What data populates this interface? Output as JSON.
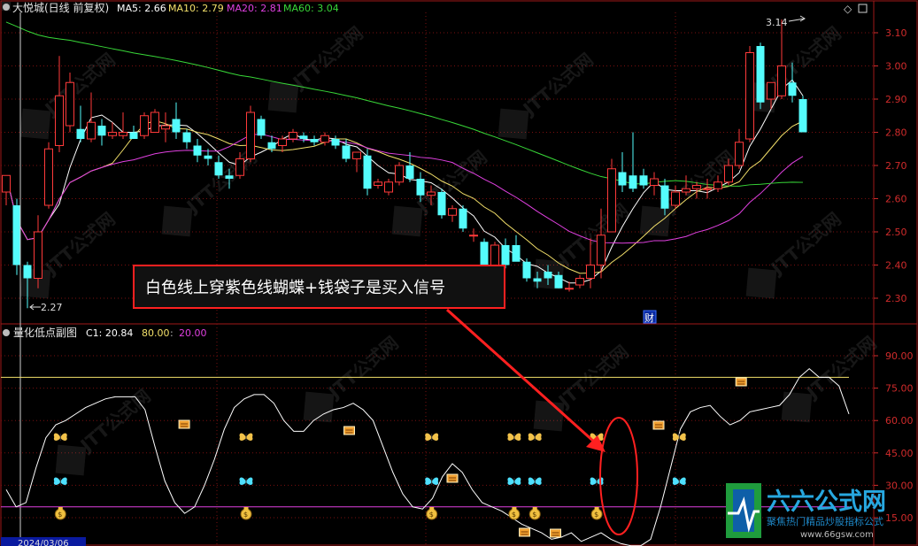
{
  "chart_data": [
    {
      "type": "candlestick",
      "title": "大悦城(日线 前复权)",
      "ma": [
        {
          "name": "MA5",
          "label": "MA5: 2.66",
          "color": "#ffffff"
        },
        {
          "name": "MA10",
          "label": "MA10: 2.79",
          "color": "#f3e06a"
        },
        {
          "name": "MA20",
          "label": "MA20: 2.81",
          "color": "#e040e0"
        },
        {
          "name": "MA60",
          "label": "MA60: 3.04",
          "color": "#38d838"
        }
      ],
      "ylim": [
        2.23,
        3.2
      ],
      "y_ticks": [
        "3.10",
        "3.00",
        "2.90",
        "2.80",
        "2.70",
        "2.60",
        "2.50",
        "2.40",
        "2.30"
      ],
      "high_label": "3.14",
      "low_label": "2.27",
      "event_label": "财",
      "annotation": "白色线上穿紫色线蝴蝶+钱袋子是买入信号",
      "candles": [
        {
          "o": 2.62,
          "h": 2.67,
          "l": 2.58,
          "c": 2.67
        },
        {
          "o": 2.58,
          "h": 2.6,
          "l": 2.37,
          "c": 2.4
        },
        {
          "o": 2.4,
          "h": 2.41,
          "l": 2.27,
          "c": 2.36
        },
        {
          "o": 2.36,
          "h": 2.55,
          "l": 2.33,
          "c": 2.5
        },
        {
          "o": 2.58,
          "h": 2.77,
          "l": 2.57,
          "c": 2.75
        },
        {
          "o": 2.76,
          "h": 3.03,
          "l": 2.74,
          "c": 2.91
        },
        {
          "o": 2.82,
          "h": 2.98,
          "l": 2.8,
          "c": 2.95
        },
        {
          "o": 2.81,
          "h": 2.88,
          "l": 2.77,
          "c": 2.78
        },
        {
          "o": 2.78,
          "h": 2.92,
          "l": 2.77,
          "c": 2.83
        },
        {
          "o": 2.82,
          "h": 2.84,
          "l": 2.76,
          "c": 2.79
        },
        {
          "o": 2.79,
          "h": 2.83,
          "l": 2.78,
          "c": 2.8
        },
        {
          "o": 2.79,
          "h": 2.86,
          "l": 2.78,
          "c": 2.8
        },
        {
          "o": 2.8,
          "h": 2.82,
          "l": 2.78,
          "c": 2.78
        },
        {
          "o": 2.79,
          "h": 2.86,
          "l": 2.78,
          "c": 2.85
        },
        {
          "o": 2.8,
          "h": 2.87,
          "l": 2.8,
          "c": 2.86
        },
        {
          "o": 2.81,
          "h": 2.86,
          "l": 2.77,
          "c": 2.82
        },
        {
          "o": 2.84,
          "h": 2.89,
          "l": 2.78,
          "c": 2.8
        },
        {
          "o": 2.8,
          "h": 2.81,
          "l": 2.75,
          "c": 2.77
        },
        {
          "o": 2.76,
          "h": 2.78,
          "l": 2.71,
          "c": 2.73
        },
        {
          "o": 2.73,
          "h": 2.75,
          "l": 2.7,
          "c": 2.72
        },
        {
          "o": 2.71,
          "h": 2.73,
          "l": 2.66,
          "c": 2.67
        },
        {
          "o": 2.67,
          "h": 2.69,
          "l": 2.63,
          "c": 2.66
        },
        {
          "o": 2.67,
          "h": 2.74,
          "l": 2.66,
          "c": 2.72
        },
        {
          "o": 2.72,
          "h": 2.88,
          "l": 2.71,
          "c": 2.86
        },
        {
          "o": 2.84,
          "h": 2.85,
          "l": 2.78,
          "c": 2.79
        },
        {
          "o": 2.77,
          "h": 2.79,
          "l": 2.74,
          "c": 2.75
        },
        {
          "o": 2.76,
          "h": 2.79,
          "l": 2.74,
          "c": 2.78
        },
        {
          "o": 2.78,
          "h": 2.81,
          "l": 2.77,
          "c": 2.8
        },
        {
          "o": 2.79,
          "h": 2.8,
          "l": 2.77,
          "c": 2.78
        },
        {
          "o": 2.78,
          "h": 2.79,
          "l": 2.76,
          "c": 2.77
        },
        {
          "o": 2.77,
          "h": 2.8,
          "l": 2.76,
          "c": 2.79
        },
        {
          "o": 2.78,
          "h": 2.79,
          "l": 2.75,
          "c": 2.76
        },
        {
          "o": 2.76,
          "h": 2.78,
          "l": 2.71,
          "c": 2.72
        },
        {
          "o": 2.72,
          "h": 2.74,
          "l": 2.68,
          "c": 2.74
        },
        {
          "o": 2.73,
          "h": 2.75,
          "l": 2.61,
          "c": 2.63
        },
        {
          "o": 2.64,
          "h": 2.66,
          "l": 2.63,
          "c": 2.65
        },
        {
          "o": 2.62,
          "h": 2.66,
          "l": 2.61,
          "c": 2.65
        },
        {
          "o": 2.65,
          "h": 2.71,
          "l": 2.64,
          "c": 2.7
        },
        {
          "o": 2.7,
          "h": 2.74,
          "l": 2.65,
          "c": 2.66
        },
        {
          "o": 2.66,
          "h": 2.68,
          "l": 2.59,
          "c": 2.61
        },
        {
          "o": 2.61,
          "h": 2.64,
          "l": 2.58,
          "c": 2.62
        },
        {
          "o": 2.62,
          "h": 2.63,
          "l": 2.54,
          "c": 2.55
        },
        {
          "o": 2.55,
          "h": 2.58,
          "l": 2.53,
          "c": 2.57
        },
        {
          "o": 2.57,
          "h": 2.58,
          "l": 2.5,
          "c": 2.51
        },
        {
          "o": 2.49,
          "h": 2.51,
          "l": 2.47,
          "c": 2.49
        },
        {
          "o": 2.47,
          "h": 2.48,
          "l": 2.38,
          "c": 2.39
        },
        {
          "o": 2.4,
          "h": 2.47,
          "l": 2.39,
          "c": 2.46
        },
        {
          "o": 2.46,
          "h": 2.48,
          "l": 2.39,
          "c": 2.4
        },
        {
          "o": 2.46,
          "h": 2.49,
          "l": 2.44,
          "c": 2.41
        },
        {
          "o": 2.41,
          "h": 2.42,
          "l": 2.35,
          "c": 2.36
        },
        {
          "o": 2.36,
          "h": 2.38,
          "l": 2.33,
          "c": 2.35
        },
        {
          "o": 2.38,
          "h": 2.4,
          "l": 2.34,
          "c": 2.36
        },
        {
          "o": 2.37,
          "h": 2.38,
          "l": 2.33,
          "c": 2.33
        },
        {
          "o": 2.33,
          "h": 2.35,
          "l": 2.32,
          "c": 2.33
        },
        {
          "o": 2.34,
          "h": 2.37,
          "l": 2.33,
          "c": 2.36
        },
        {
          "o": 2.36,
          "h": 2.48,
          "l": 2.33,
          "c": 2.4
        },
        {
          "o": 2.4,
          "h": 2.57,
          "l": 2.36,
          "c": 2.49
        },
        {
          "o": 2.5,
          "h": 2.72,
          "l": 2.5,
          "c": 2.69
        },
        {
          "o": 2.68,
          "h": 2.74,
          "l": 2.62,
          "c": 2.64
        },
        {
          "o": 2.67,
          "h": 2.8,
          "l": 2.62,
          "c": 2.63
        },
        {
          "o": 2.67,
          "h": 2.69,
          "l": 2.63,
          "c": 2.64
        },
        {
          "o": 2.64,
          "h": 2.68,
          "l": 2.61,
          "c": 2.66
        },
        {
          "o": 2.64,
          "h": 2.66,
          "l": 2.55,
          "c": 2.57
        },
        {
          "o": 2.58,
          "h": 2.64,
          "l": 2.57,
          "c": 2.62
        },
        {
          "o": 2.62,
          "h": 2.67,
          "l": 2.61,
          "c": 2.63
        },
        {
          "o": 2.63,
          "h": 2.65,
          "l": 2.6,
          "c": 2.64
        },
        {
          "o": 2.63,
          "h": 2.66,
          "l": 2.6,
          "c": 2.63
        },
        {
          "o": 2.63,
          "h": 2.67,
          "l": 2.62,
          "c": 2.65
        },
        {
          "o": 2.65,
          "h": 2.72,
          "l": 2.64,
          "c": 2.7
        },
        {
          "o": 2.7,
          "h": 2.81,
          "l": 2.69,
          "c": 2.77
        },
        {
          "o": 2.78,
          "h": 3.06,
          "l": 2.77,
          "c": 3.04
        },
        {
          "o": 3.06,
          "h": 3.07,
          "l": 2.87,
          "c": 2.89
        },
        {
          "o": 2.9,
          "h": 2.95,
          "l": 2.87,
          "c": 2.95
        },
        {
          "o": 2.91,
          "h": 3.14,
          "l": 2.9,
          "c": 3.0
        },
        {
          "o": 2.95,
          "h": 3.01,
          "l": 2.89,
          "c": 2.91
        },
        {
          "o": 2.9,
          "h": 2.91,
          "l": 2.8,
          "c": 2.8
        }
      ]
    },
    {
      "type": "line",
      "title": "量化低点副图",
      "c1_label": "C1: 20.84",
      "line80_label": "80.00",
      "line20_label": "20.00",
      "ylim": [
        0,
        100
      ],
      "y_ticks": [
        "90.00",
        "75.00",
        "60.00",
        "45.00",
        "30.00",
        "15.00"
      ],
      "upper_line": 80,
      "lower_line": 20,
      "date_label": "2024/03/06",
      "series": [
        {
          "values": [
            28,
            20,
            22,
            38,
            52,
            58,
            60,
            63,
            66,
            68,
            70,
            71,
            71,
            71,
            65,
            48,
            32,
            22,
            17,
            20,
            30,
            42,
            56,
            66,
            70,
            72,
            72,
            68,
            60,
            55,
            55,
            60,
            63,
            65,
            66,
            68,
            65,
            60,
            48,
            36,
            26,
            20,
            19,
            24,
            34,
            40,
            36,
            28,
            22,
            20,
            18,
            15,
            12,
            10,
            8,
            5,
            6,
            8,
            4,
            6,
            8,
            5,
            3,
            2,
            2,
            5,
            20,
            38,
            56,
            64,
            66,
            67,
            62,
            58,
            60,
            64,
            65,
            66,
            67,
            72,
            80,
            84,
            80,
            80,
            76,
            63
          ]
        }
      ],
      "signals": [
        {
          "type": "yellow-butterfly",
          "i": 1
        },
        {
          "type": "cyan-butterfly",
          "i": 1
        },
        {
          "type": "money-bag",
          "i": 1
        },
        {
          "type": "yellow-box",
          "i": 7
        },
        {
          "type": "yellow-butterfly",
          "i": 10
        },
        {
          "type": "cyan-butterfly",
          "i": 10
        },
        {
          "type": "money-bag",
          "i": 10
        },
        {
          "type": "yellow-box",
          "i": 15
        },
        {
          "type": "yellow-butterfly",
          "i": 19
        },
        {
          "type": "cyan-butterfly",
          "i": 19
        },
        {
          "type": "money-bag",
          "i": 19
        },
        {
          "type": "yellow-box",
          "i": 20
        },
        {
          "type": "yellow-butterfly",
          "i": 23
        },
        {
          "type": "yellow-butterfly",
          "i": 24
        },
        {
          "type": "cyan-butterfly",
          "i": 23
        },
        {
          "type": "cyan-butterfly",
          "i": 24
        },
        {
          "type": "money-bag",
          "i": 23
        },
        {
          "type": "money-bag",
          "i": 24
        },
        {
          "type": "yellow-box",
          "i": 23.5
        },
        {
          "type": "yellow-box",
          "i": 25
        },
        {
          "type": "yellow-butterfly",
          "i": 27
        },
        {
          "type": "cyan-butterfly",
          "i": 27
        },
        {
          "type": "money-bag",
          "i": 27
        },
        {
          "type": "yellow-box",
          "i": 30
        },
        {
          "type": "yellow-butterfly",
          "i": 31
        },
        {
          "type": "cyan-butterfly",
          "i": 31
        },
        {
          "type": "yellow-box",
          "i": 34
        }
      ]
    }
  ],
  "watermark": {
    "brand": "六六公式网",
    "slogan": "聚焦热门精品炒股指标公式",
    "url": "www.66gsw.com",
    "repeat_text": "JTT公式网"
  },
  "colors": {
    "up": "#ff3a3a",
    "down": "#54fcfc",
    "grid": "#7a0f0f",
    "axis_text": "#d02b2b",
    "annotation_border": "#ff2020",
    "arrow": "#ff2020"
  }
}
